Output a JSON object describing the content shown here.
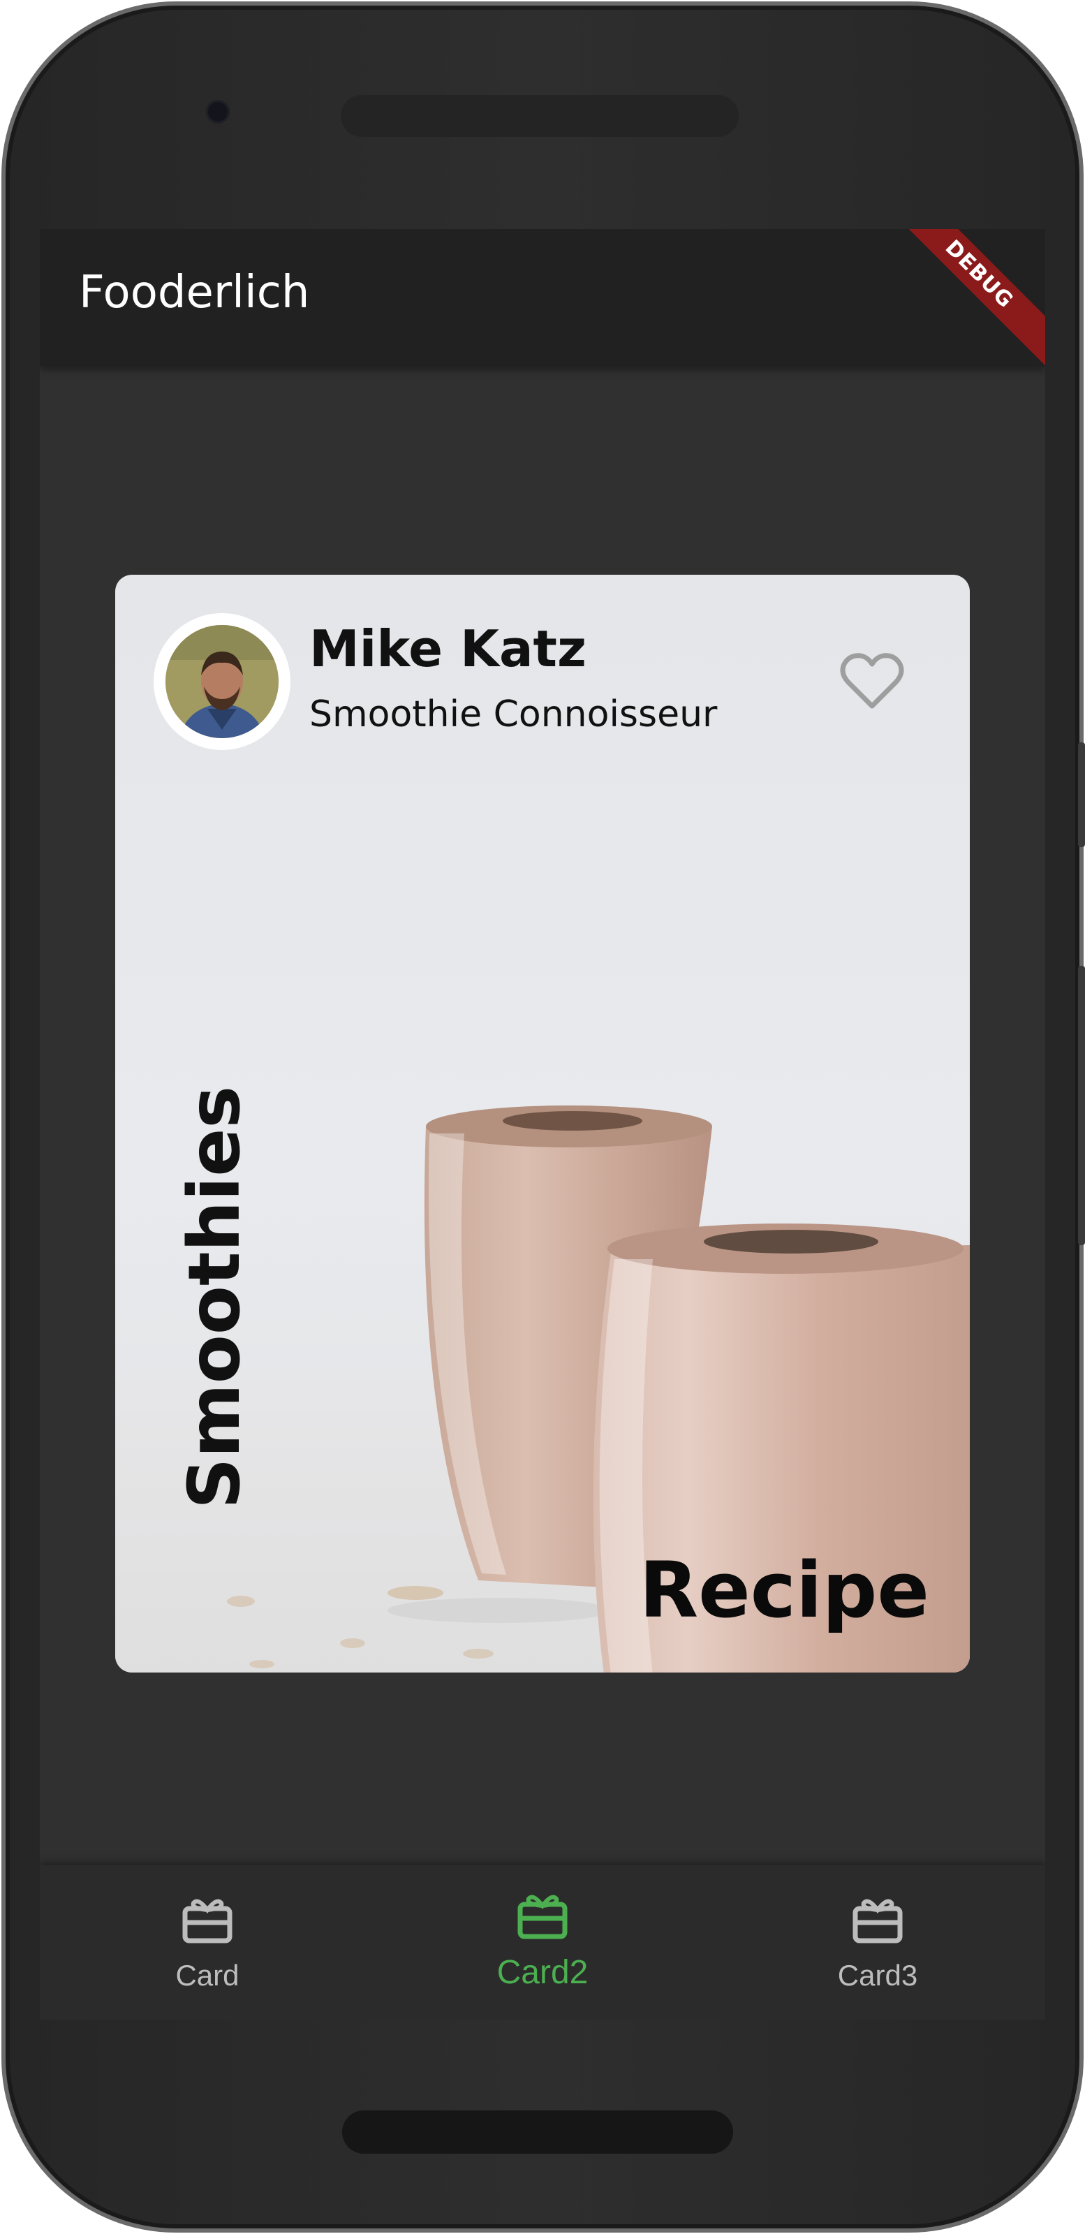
{
  "app": {
    "title": "Fooderlich",
    "debug_banner": "DEBUG"
  },
  "card": {
    "author_name": "Mike Katz",
    "author_title": "Smoothie Connoisseur",
    "favorite_icon": "heart-outline-icon",
    "vertical_title": "Smoothies",
    "label": "Recipe"
  },
  "bottom_nav": {
    "items": [
      {
        "label": "Card",
        "icon": "card-giftcard-icon"
      },
      {
        "label": "Card2",
        "icon": "card-giftcard-icon"
      },
      {
        "label": "Card3",
        "icon": "card-giftcard-icon"
      }
    ],
    "selected_index": 1
  },
  "colors": {
    "selected_accent": "#4caf50",
    "unselected": "#bdbdbd",
    "app_bar": "#212121",
    "debug_banner": "#8b1a1a"
  }
}
